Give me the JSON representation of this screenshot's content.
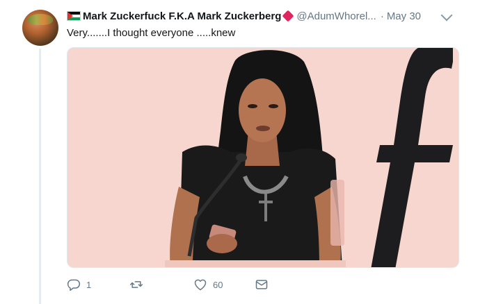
{
  "tweet": {
    "author": {
      "display_name": "Mark Zuckerfuck F.K.A Mark Zuckerberg",
      "handle": "@AdumWhorel...",
      "flag_icon": "palestine-flag-icon",
      "badge_icon": "red-diamond-icon"
    },
    "separator": "·",
    "date": "May 30",
    "text": "Very.......I thought everyone .....knew",
    "actions": {
      "reply": {
        "icon": "reply-icon",
        "count": "1"
      },
      "retweet": {
        "icon": "retweet-icon",
        "count": ""
      },
      "like": {
        "icon": "heart-icon",
        "count": "60"
      },
      "message": {
        "icon": "envelope-icon"
      }
    }
  },
  "colors": {
    "text": "#14171a",
    "muted": "#657786",
    "media_background": "#f6d6cf",
    "thread_line": "#e6ecf0"
  }
}
